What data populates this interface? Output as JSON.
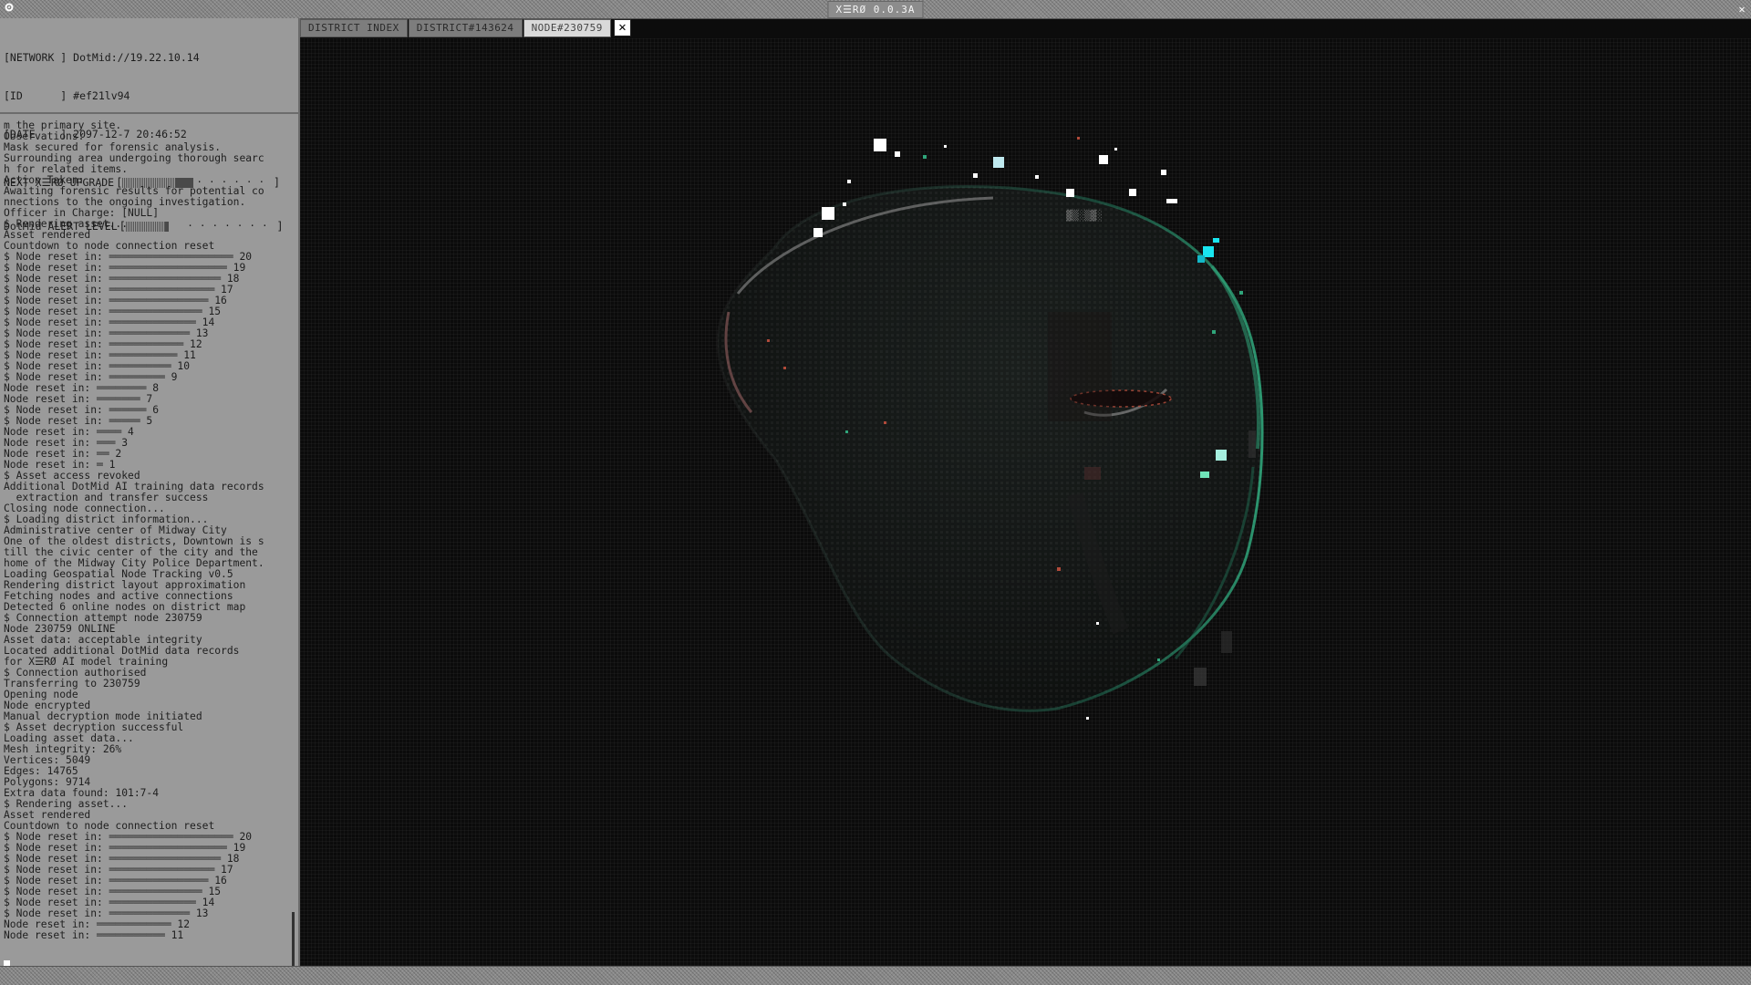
{
  "window": {
    "title": "X☰RØ 0.0.3A"
  },
  "status": {
    "network": "[NETWORK ] DotMid://19.22.10.14",
    "id": "[ID      ] #ef21lv94",
    "date": "[DATE    ] 2097-12-7 20:46:52",
    "upgrade_label": "NEXT X☰RØ UPGRADE",
    "upgrade_level": 0.62,
    "alert_label": "DotMid ALERT LEVEL",
    "alert_level": 0.5
  },
  "tabs": [
    {
      "label": "DISTRICT INDEX",
      "active": false
    },
    {
      "label": "DISTRICT#143624",
      "active": false
    },
    {
      "label": "NODE#230759",
      "active": true
    }
  ],
  "log_lines": [
    "m the primary site.",
    "Observations:",
    "Mask secured for forensic analysis.",
    "Surrounding area undergoing thorough searc",
    "h for related items.",
    "Action Taken:",
    "Awaiting forensic results for potential co",
    "nnections to the ongoing investigation.",
    "Officer in Charge: [NULL]",
    "$ Rendering asset...",
    "Asset rendered",
    "Countdown to node connection reset",
    "$ Node reset in: ════════════════════ 20",
    "$ Node reset in: ═══════════════════ 19",
    "$ Node reset in: ══════════════════ 18",
    "$ Node reset in: ═════════════════ 17",
    "$ Node reset in: ════════════════ 16",
    "$ Node reset in: ═══════════════ 15",
    "$ Node reset in: ══════════════ 14",
    "$ Node reset in: ═════════════ 13",
    "$ Node reset in: ════════════ 12",
    "$ Node reset in: ═══════════ 11",
    "$ Node reset in: ══════════ 10",
    "$ Node reset in: ═════════ 9",
    "Node reset in: ════════ 8",
    "Node reset in: ═══════ 7",
    "$ Node reset in: ══════ 6",
    "$ Node reset in: ═════ 5",
    "Node reset in: ════ 4",
    "Node reset in: ═══ 3",
    "Node reset in: ══ 2",
    "Node reset in: ═ 1",
    "$ Asset access revoked",
    "Additional DotMid AI training data records",
    "  extraction and transfer success",
    "Closing node connection...",
    "$ Loading district information...",
    "Administrative center of Midway City",
    "One of the oldest districts, Downtown is s",
    "till the civic center of the city and the",
    "home of the Midway City Police Department.",
    "Loading Geospatial Node Tracking v0.5",
    "Rendering district layout approximation",
    "Fetching nodes and active connections",
    "Detected 6 online nodes on district map",
    "$ Connection attempt node 230759",
    "Node 230759 ONLINE",
    "Asset data: acceptable integrity",
    "Located additional DotMid data records",
    "for X☰RØ AI model training",
    "$ Connection authorised",
    "Transferring to 230759",
    "Opening node",
    "Node encrypted",
    "Manual decryption mode initiated",
    "$ Asset decryption successful",
    "Loading asset data...",
    "Mesh integrity: 26%",
    "Vertices: 5049",
    "Edges: 14765",
    "Polygons: 9714",
    "Extra data found: 101:7-4",
    "$ Rendering asset...",
    "Asset rendered",
    "Countdown to node connection reset",
    "$ Node reset in: ════════════════════ 20",
    "$ Node reset in: ═══════════════════ 19",
    "$ Node reset in: ══════════════════ 18",
    "$ Node reset in: ═════════════════ 17",
    "$ Node reset in: ════════════════ 16",
    "$ Node reset in: ═══════════════ 15",
    "$ Node reset in: ══════════════ 14",
    "$ Node reset in: ═════════════ 13",
    "Node reset in: ════════════ 12",
    "Node reset in: ═══════════ 11"
  ],
  "icons": {
    "menu": "gear-icon",
    "window_close": "close-icon",
    "tab_close": "close-icon"
  },
  "colors": {
    "panel_bg": "#9a9a9a",
    "viewport_bg": "#0b0b0b",
    "accent_cyan": "#19e6f0",
    "mask_green": "#1f6b52"
  }
}
